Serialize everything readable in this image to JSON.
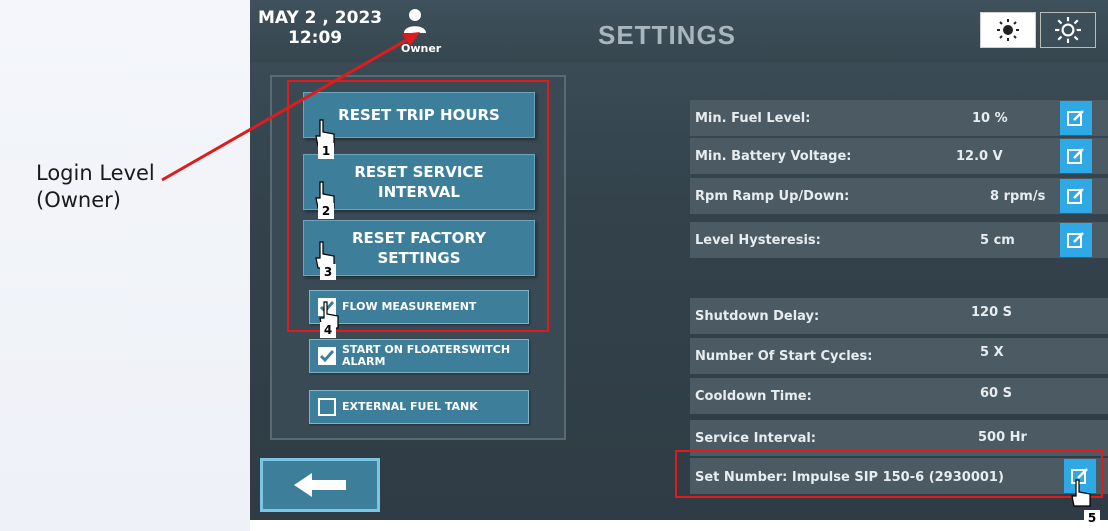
{
  "annotation": {
    "label_line1": "Login Level",
    "label_line2": "(Owner)"
  },
  "header": {
    "date": "MAY   2 , 2023",
    "time": "12:09",
    "user_label": "Owner",
    "title": "SETTINGS"
  },
  "actions": {
    "reset_trip_hours": "RESET TRIP HOURS",
    "reset_service_line1": "RESET SERVICE",
    "reset_service_line2": "INTERVAL",
    "reset_factory_line1": "RESET FACTORY",
    "reset_factory_line2": "SETTINGS"
  },
  "options": {
    "flow_measurement": {
      "label": "FLOW MEASUREMENT",
      "checked": true
    },
    "start_floater_line1": "START ON FLOATERSWITCH",
    "start_floater_line2": "ALARM",
    "start_floater_checked": true,
    "external_fuel_tank": {
      "label": "EXTERNAL FUEL TANK",
      "checked": false
    }
  },
  "settings_group1": [
    {
      "label": "Min. Fuel Level:",
      "value": "10 %"
    },
    {
      "label": "Min. Battery Voltage:",
      "value": "12.0 V"
    },
    {
      "label": "Rpm Ramp Up/Down:",
      "value": "8 rpm/s"
    },
    {
      "label": "Level Hysteresis:",
      "value": "5 cm"
    }
  ],
  "settings_group2": [
    {
      "label": "Shutdown Delay:",
      "value": "120 S"
    },
    {
      "label": "Number Of Start Cycles:",
      "value": "5 X"
    },
    {
      "label": "Cooldown Time:",
      "value": "60 S"
    },
    {
      "label": "Service Interval:",
      "value": "500 Hr"
    },
    {
      "label": "Set Number:  Impulse SIP 150-6 (2930001)",
      "value": ""
    }
  ],
  "step_numbers": [
    "1",
    "2",
    "3",
    "4",
    "5"
  ],
  "colors": {
    "accent": "#3d7f9b",
    "edit": "#2fa8e6",
    "annotation_red": "#e01b1b"
  }
}
